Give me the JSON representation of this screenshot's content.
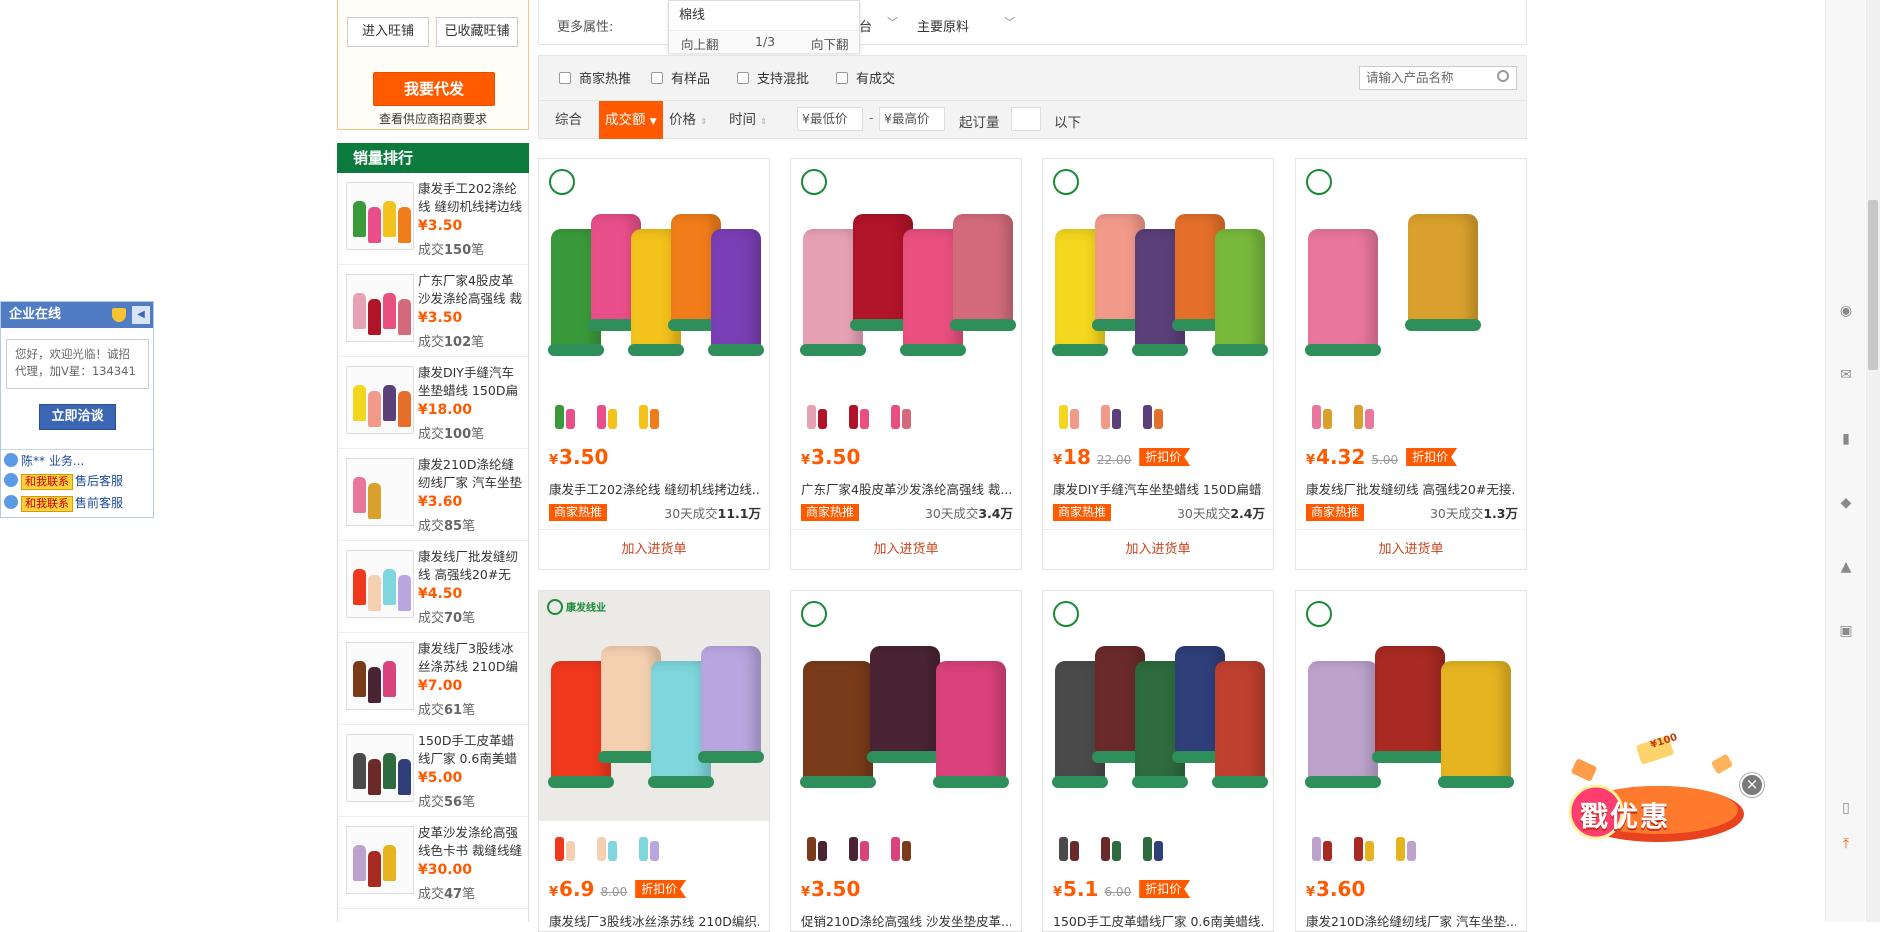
{
  "shop": {
    "enter_label": "进入旺铺",
    "fav_label": "已收藏旺铺",
    "daifa_label": "我要代发",
    "daifa_note": "查看供应商招商要求"
  },
  "ranking": {
    "title": "销量排行",
    "items": [
      {
        "title": "康发手工202涤纶线 缝纫机线拷边线",
        "price": "¥3.50",
        "sold_prefix": "成交",
        "sold": "150",
        "sold_suffix": "笔"
      },
      {
        "title": "广东厂家4股皮革沙发涤纶高强线 裁",
        "price": "¥3.50",
        "sold_prefix": "成交",
        "sold": "102",
        "sold_suffix": "笔"
      },
      {
        "title": "康发DIY手缝汽车坐垫蜡线 150D扁",
        "price": "¥18.00",
        "sold_prefix": "成交",
        "sold": "100",
        "sold_suffix": "笔"
      },
      {
        "title": "康发210D涤纶缝纫线厂家 汽车坐垫",
        "price": "¥3.60",
        "sold_prefix": "成交",
        "sold": "85",
        "sold_suffix": "笔"
      },
      {
        "title": "康发线厂批发缝纫线 高强线20#无接",
        "price": "¥4.50",
        "sold_prefix": "成交",
        "sold": "70",
        "sold_suffix": "笔"
      },
      {
        "title": "康发线厂3股线冰丝涤苏线 210D编",
        "price": "¥7.00",
        "sold_prefix": "成交",
        "sold": "61",
        "sold_suffix": "笔"
      },
      {
        "title": "150D手工皮革蜡线厂家 0.6南美蜡",
        "price": "¥5.00",
        "sold_prefix": "成交",
        "sold": "56",
        "sold_suffix": "笔"
      },
      {
        "title": "皮革沙发涤纶高强线色卡书 裁缝线缝",
        "price": "¥30.00",
        "sold_prefix": "成交",
        "sold": "47",
        "sold_suffix": "笔"
      }
    ]
  },
  "online": {
    "title": "企业在线",
    "message": "您好，欢迎光临！诚招代理，加V星：134341",
    "consult_label": "立即洽谈",
    "agent": "陈** 业务...",
    "contact_tag": "和我联系",
    "after_sale": "售后客服",
    "pre_sale": "售前客服"
  },
  "attributes": {
    "more_label": "更多属性:",
    "popup_item": "棉线",
    "prev_label": "向上翻",
    "page": "1/3",
    "next_label": "向下翻",
    "partial_label": "台",
    "material_label": "主要原料"
  },
  "filters": {
    "checks": [
      "商家热推",
      "有样品",
      "支持混批",
      "有成交"
    ],
    "search_placeholder": "请输入产品名称",
    "sorts": [
      "综合",
      "成交额",
      "价格",
      "时间"
    ],
    "min_price_placeholder": "¥最低价",
    "max_price_placeholder": "¥最高价",
    "dash": "-",
    "moq_label": "起订量",
    "moq_suffix": "以下"
  },
  "products": [
    {
      "price": "3.50",
      "old_price": "",
      "discount": "",
      "title": "康发手工202涤纶线 缝纫机线拷边线...",
      "hot": "商家热推",
      "sold_label": "30天成交",
      "sold": "11.1万",
      "cart": "加入进货单",
      "colors": [
        "#3a9a3a",
        "#e84f8a",
        "#f4c21c",
        "#f07d1a",
        "#7b3fb5"
      ]
    },
    {
      "price": "3.50",
      "old_price": "",
      "discount": "",
      "title": "广东厂家4股皮革沙发涤纶高强线 裁...",
      "hot": "商家热推",
      "sold_label": "30天成交",
      "sold": "3.4万",
      "cart": "加入进货单",
      "colors": [
        "#e7a1b5",
        "#b01428",
        "#e9507f",
        "#d46b7c"
      ]
    },
    {
      "price": "18",
      "old_price": "22.00",
      "discount": "折扣价",
      "title": "康发DIY手缝汽车坐垫蜡线 150D扁蜡...",
      "hot": "商家热推",
      "sold_label": "30天成交",
      "sold": "2.4万",
      "cart": "加入进货单",
      "colors": [
        "#f3d61e",
        "#f29a8a",
        "#5b3f79",
        "#e46f2a",
        "#78b93c"
      ]
    },
    {
      "price": "4.32",
      "old_price": "5.00",
      "discount": "折扣价",
      "title": "康发线厂批发缝纫线 高强线20#无接...",
      "hot": "商家热推",
      "sold_label": "30天成交",
      "sold": "1.3万",
      "cart": "加入进货单",
      "colors": [
        "#e9769c",
        "#d9a02c"
      ]
    },
    {
      "price": "6.9",
      "old_price": "8.00",
      "discount": "折扣价",
      "title": "康发线厂3股线冰丝涤苏线 210D编织...",
      "hot": "",
      "sold_label": "",
      "sold": "",
      "cart": "",
      "colors": [
        "#f0381d",
        "#f5d0b0",
        "#7fd6dd",
        "#b9a6e0"
      ]
    },
    {
      "price": "3.50",
      "old_price": "",
      "discount": "",
      "title": "促销210D涤纶高强线 沙发坐垫皮革...",
      "hot": "",
      "sold_label": "",
      "sold": "",
      "cart": "",
      "colors": [
        "#7a3b1a",
        "#4a2434",
        "#d9427a"
      ]
    },
    {
      "price": "5.1",
      "old_price": "6.00",
      "discount": "折扣价",
      "title": "150D手工皮革蜡线厂家 0.6南美蜡线...",
      "hot": "",
      "sold_label": "",
      "sold": "",
      "cart": "",
      "colors": [
        "#4a4a4a",
        "#6b2a2a",
        "#2e6b3e",
        "#2e3f7a",
        "#c0402f"
      ]
    },
    {
      "price": "3.60",
      "old_price": "",
      "discount": "",
      "title": "康发210D涤纶缝纫线厂家 汽车坐垫...",
      "hot": "",
      "sold_label": "",
      "sold": "",
      "cart": "",
      "colors": [
        "#bda3cc",
        "#a82a22",
        "#e6b421"
      ]
    }
  ],
  "product_brand_text": "康发线业",
  "coupon": {
    "text": "戳优惠",
    "tag": "¥100",
    "close": "×"
  },
  "colors": {
    "accent": "#ff5a00",
    "ranking_header": "#0b7a3c",
    "online_header": "#4f7cc3"
  }
}
